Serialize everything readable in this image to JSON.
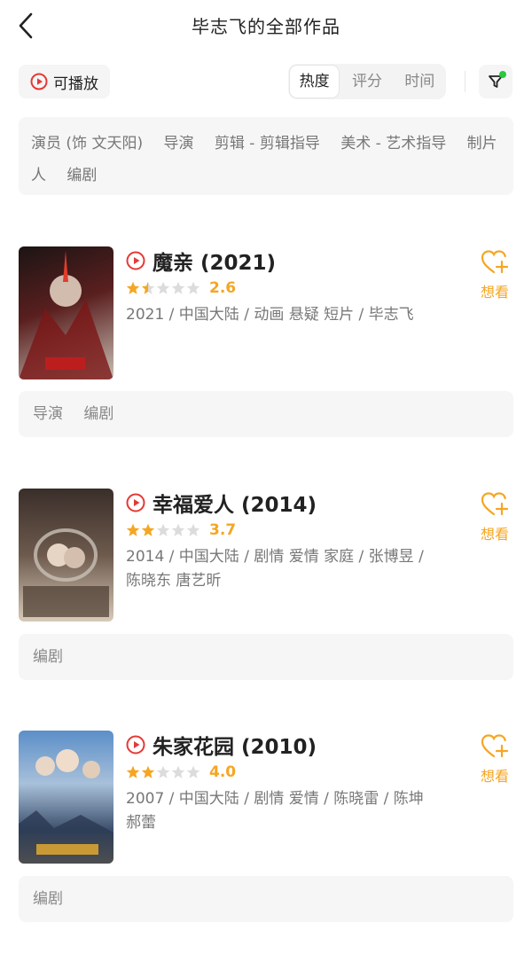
{
  "header": {
    "title": "毕志飞的全部作品"
  },
  "toolbar": {
    "play_filter_label": "可播放",
    "sort_tabs": [
      {
        "label": "热度",
        "active": true
      },
      {
        "label": "评分",
        "active": false
      },
      {
        "label": "时间",
        "active": false
      }
    ],
    "filter_active_dot_color": "#28c840"
  },
  "roles_summary": [
    "演员 (饰 文天阳)",
    "导演",
    "剪辑 - 剪辑指导",
    "美术 - 艺术指导",
    "制片人",
    "编剧"
  ],
  "works": [
    {
      "title": "魔亲 (2021)",
      "rating_stars": 1.5,
      "score": "2.6",
      "meta": "2021 / 中国大陆 / 动画 悬疑 短片 / 毕志飞",
      "want_label": "想看",
      "roles": [
        "导演",
        "编剧"
      ],
      "poster_colors": [
        "#2a1a1a",
        "#b23030",
        "#e8e0d8"
      ]
    },
    {
      "title": "幸福爱人 (2014)",
      "rating_stars": 2,
      "score": "3.7",
      "meta": "2014 / 中国大陆 / 剧情 爱情 家庭 / 张博昱 / 陈晓东 唐艺昕",
      "want_label": "想看",
      "roles": [
        "编剧"
      ],
      "poster_colors": [
        "#3a2e2a",
        "#8a7564",
        "#d9c9b5"
      ]
    },
    {
      "title": "朱家花园 (2010)",
      "rating_stars": 2,
      "score": "4.0",
      "meta": "2007 / 中国大陆 / 剧情 爱情 / 陈晓雷 / 陈坤 郝蕾",
      "want_label": "想看",
      "roles": [
        "编剧"
      ],
      "poster_colors": [
        "#4a7fb8",
        "#2c3b55",
        "#e9e2d4"
      ]
    }
  ],
  "colors": {
    "accent": "#f5a623",
    "play_red": "#e53935",
    "star_empty": "#dcdcdc"
  }
}
